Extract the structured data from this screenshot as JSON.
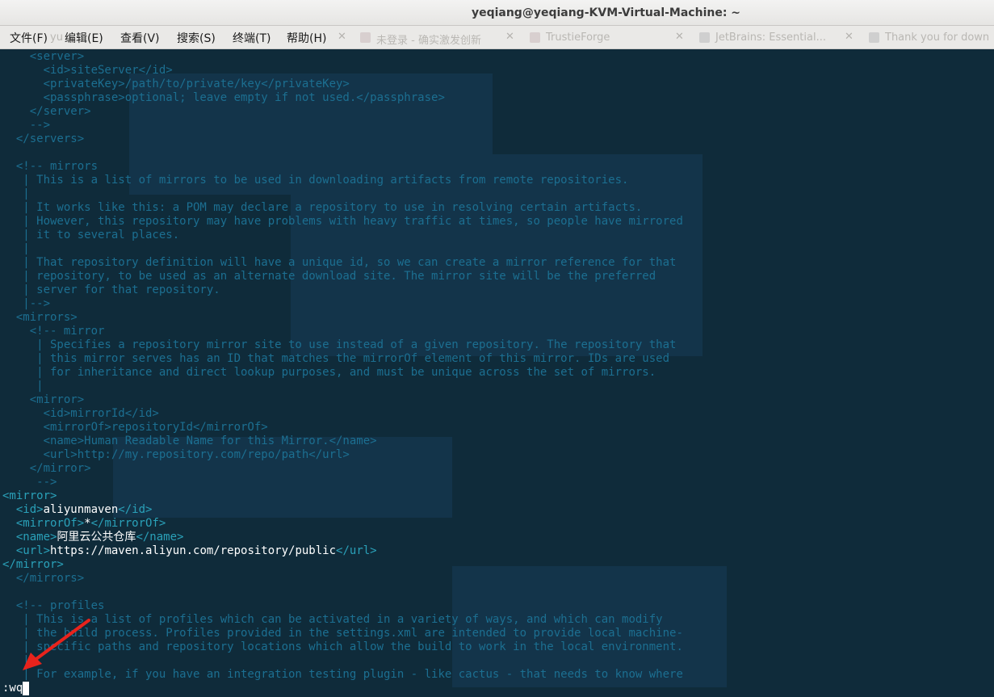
{
  "window": {
    "title": "yeqiang@yeqiang-KVM-Virtual-Machine: ~"
  },
  "menu": [
    {
      "label": "文件(F)"
    },
    {
      "label": "编辑(E)"
    },
    {
      "label": "查看(V)"
    },
    {
      "label": "搜索(S)"
    },
    {
      "label": "终端(T)"
    },
    {
      "label": "帮助(H)"
    }
  ],
  "background_tabs": [
    {
      "label": "未登录 - 确实激发创新"
    },
    {
      "label": "TrustieForge"
    },
    {
      "label": "JetBrains: Essential..."
    },
    {
      "label": "Thank you for down"
    }
  ],
  "terminal": {
    "lines": [
      "    <server>",
      "      <id>siteServer</id>",
      "      <privateKey>/path/to/private/key</privateKey>",
      "      <passphrase>optional; leave empty if not used.</passphrase>",
      "    </server>",
      "    -->",
      "  </servers>",
      "",
      "  <!-- mirrors",
      "   | This is a list of mirrors to be used in downloading artifacts from remote repositories.",
      "   |",
      "   | It works like this: a POM may declare a repository to use in resolving certain artifacts.",
      "   | However, this repository may have problems with heavy traffic at times, so people have mirrored",
      "   | it to several places.",
      "   |",
      "   | That repository definition will have a unique id, so we can create a mirror reference for that",
      "   | repository, to be used as an alternate download site. The mirror site will be the preferred",
      "   | server for that repository.",
      "   |-->",
      "  <mirrors>",
      "    <!-- mirror",
      "     | Specifies a repository mirror site to use instead of a given repository. The repository that",
      "     | this mirror serves has an ID that matches the mirrorOf element of this mirror. IDs are used",
      "     | for inheritance and direct lookup purposes, and must be unique across the set of mirrors.",
      "     |",
      "    <mirror>",
      "      <id>mirrorId</id>",
      "      <mirrorOf>repositoryId</mirrorOf>",
      "      <name>Human Readable Name for this Mirror.</name>",
      "      <url>http://my.repository.com/repo/path</url>",
      "    </mirror>",
      "     -->"
    ],
    "mirror_block": [
      {
        "indent": "",
        "open": "<mirror>",
        "text": "",
        "close": ""
      },
      {
        "indent": "  ",
        "open": "<id>",
        "text": "aliyunmaven",
        "close": "</id>"
      },
      {
        "indent": "  ",
        "open": "<mirrorOf>",
        "text": "*",
        "close": "</mirrorOf>"
      },
      {
        "indent": "  ",
        "open": "<name>",
        "text": "阿里云公共仓库",
        "close": "</name>"
      },
      {
        "indent": "  ",
        "open": "<url>",
        "text": "https://maven.aliyun.com/repository/public",
        "close": "</url>"
      },
      {
        "indent": "",
        "open": "</mirror>",
        "text": "",
        "close": ""
      }
    ],
    "tail_lines": [
      "  </mirrors>",
      "",
      "  <!-- profiles",
      "   | This is a list of profiles which can be activated in a variety of ways, and which can modify",
      "   | the build process. Profiles provided in the settings.xml are intended to provide local machine-",
      "   | specific paths and repository locations which allow the build to work in the local environment.",
      "   |",
      "   | For example, if you have an integration testing plugin - like cactus - that needs to know where"
    ],
    "command": ":wq"
  },
  "colors": {
    "terminal_bg": "#0f2b3a",
    "text_dim": "#1c6f91",
    "tag_bright": "#2aa1b9",
    "arrow": "#e8231c"
  }
}
